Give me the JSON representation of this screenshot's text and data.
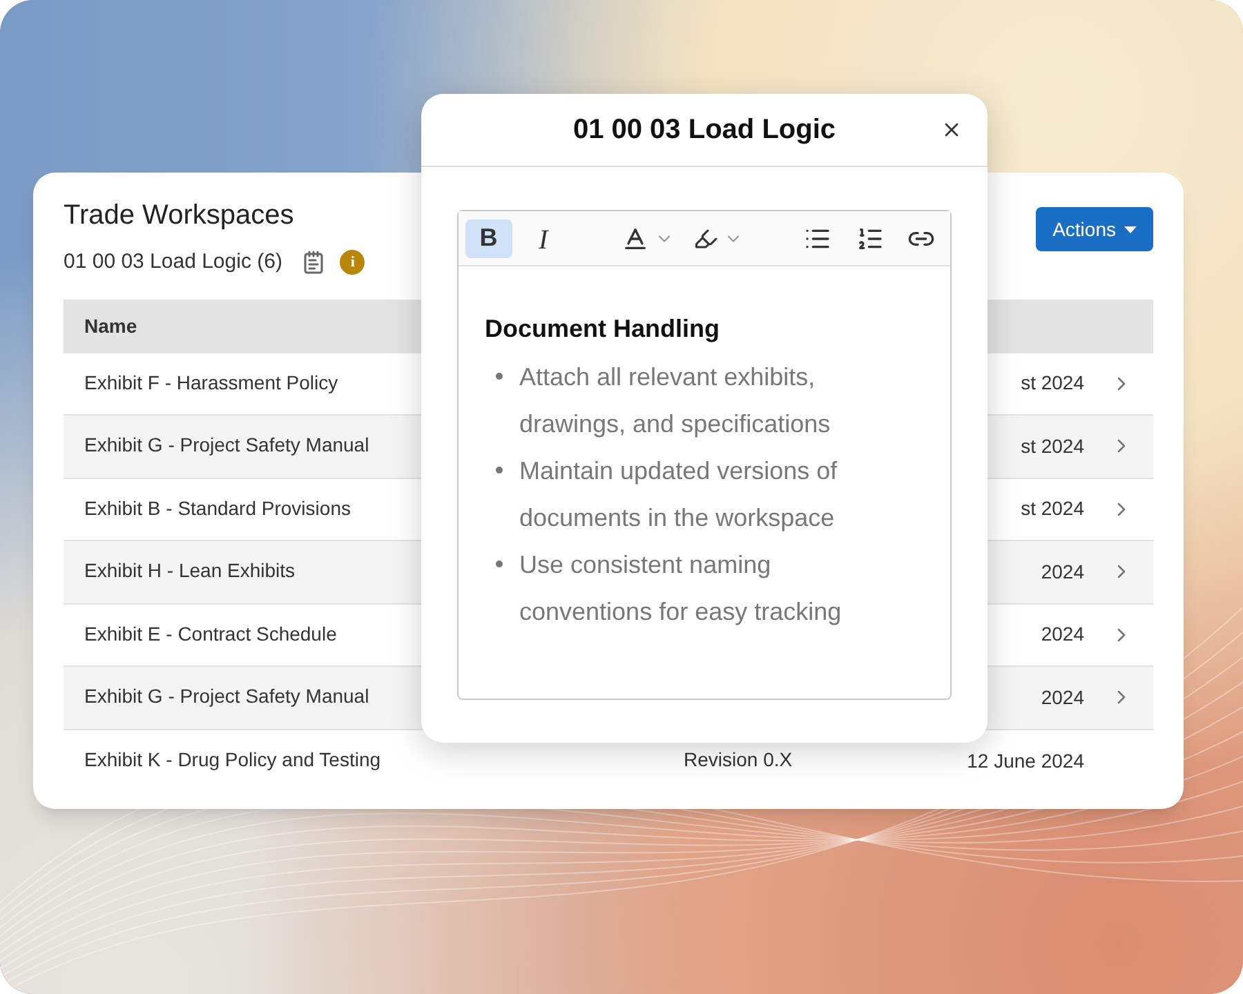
{
  "workspace": {
    "title": "Trade Workspaces",
    "subtitle": "01 00 03 Load Logic (6)",
    "info_badge": "i",
    "actions_button": "Actions",
    "table": {
      "columns": [
        "Name"
      ],
      "rows": [
        {
          "name": "Exhibit F - Harassment Policy",
          "column_3": "st 2024",
          "chevron": true
        },
        {
          "name": "Exhibit G - Project Safety Manual",
          "column_3": "st 2024",
          "chevron": true
        },
        {
          "name": "Exhibit B - Standard Provisions",
          "column_3": "st 2024",
          "chevron": true
        },
        {
          "name": "Exhibit H - Lean Exhibits",
          "column_3": "2024",
          "chevron": true
        },
        {
          "name": "Exhibit E - Contract Schedule",
          "column_3": "2024",
          "chevron": true
        },
        {
          "name": "Exhibit G - Project Safety Manual",
          "column_3": "2024",
          "chevron": true
        },
        {
          "name": "Exhibit K - Drug Policy and Testing",
          "column_2": "Revision 0.X",
          "column_3": "12 June 2024",
          "chevron": false
        }
      ]
    }
  },
  "modal": {
    "title": "01 00 03 Load Logic",
    "toolbar": [
      {
        "kind": "bold",
        "label": "B",
        "selected": true
      },
      {
        "kind": "italic",
        "label": "I",
        "selected": false
      },
      {
        "kind": "text-color",
        "selected": false
      },
      {
        "kind": "highlight",
        "selected": false
      },
      {
        "kind": "bullet-list",
        "selected": false
      },
      {
        "kind": "numbered-list",
        "selected": false
      },
      {
        "kind": "link",
        "selected": false
      }
    ],
    "heading": "Document Handling",
    "bullets": [
      "Attach all relevant exhibits, drawings, and specifications",
      "Maintain updated versions of documents in the workspace",
      "Use consistent naming conventions for easy tracking"
    ]
  }
}
